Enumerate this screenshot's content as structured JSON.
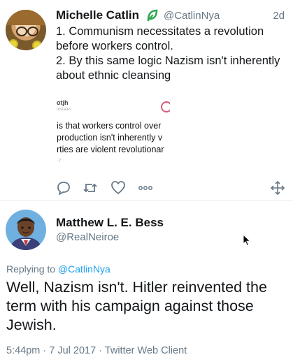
{
  "tweet1": {
    "display_name": "Michelle Catlin",
    "handle": "@CatlinNya",
    "time": "2d",
    "text": "1. Communism necessitates a revolution before workers control.\n2. By this same logic Nazism isn't inherently about ethnic cleansing",
    "embed": {
      "title": "otjh",
      "subtitle": "ntstates",
      "lines": [
        "is that workers control over",
        " production isn't inherently v",
        "rties are violent revolutionar"
      ],
      "footer": "·7"
    },
    "actions": [
      "reply-icon",
      "retweet-icon",
      "like-icon",
      "more-icon",
      "move-icon"
    ]
  },
  "tweet2": {
    "display_name": "Matthew L. E. Bess",
    "handle": "@RealNeiroe",
    "reply_prefix": "Replying to ",
    "reply_to": "@CatlinNya",
    "text": "Well, Nazism isn't. Hitler reinvented the term with his campaign against those Jewish.",
    "meta": "5:44pm · 7 Jul 2017 · Twitter Web Client"
  },
  "colors": {
    "link": "#1da1f2",
    "secondary": "#657786",
    "icon": "#657786",
    "leaf": "#2fa84f"
  }
}
